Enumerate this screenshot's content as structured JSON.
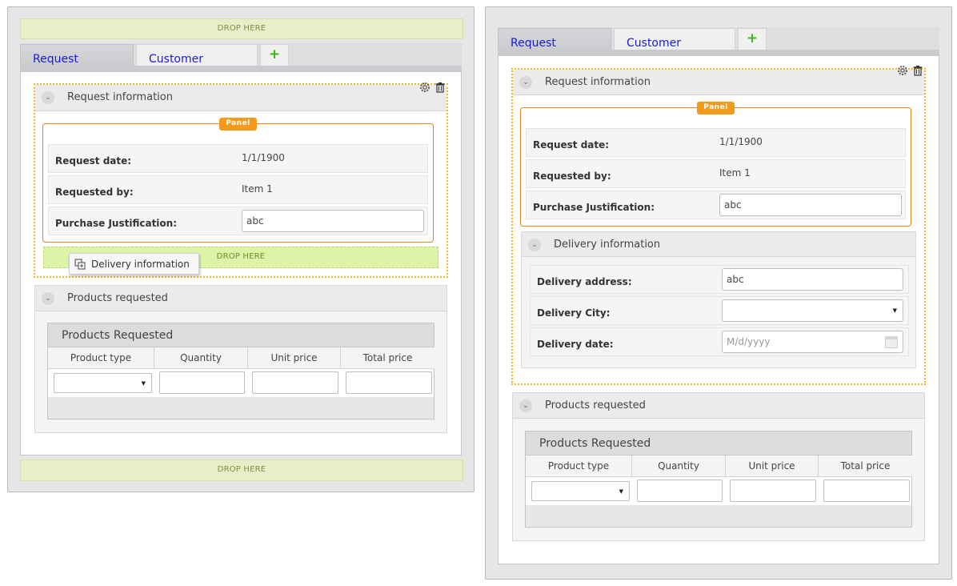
{
  "drop_label": "DROP HERE",
  "tabs": {
    "request": "Request",
    "customer": "Customer",
    "add": "+"
  },
  "sections": {
    "request_info": "Request information",
    "delivery_info": "Delivery information",
    "products_requested": "Products requested"
  },
  "panel_tag": "Panel",
  "request_fields": {
    "request_date_label": "Request date:",
    "request_date_value": "1/1/1900",
    "requested_by_label": "Requested by:",
    "requested_by_value": "Item 1",
    "justification_label": "Purchase Justification:",
    "justification_value": "abc"
  },
  "delivery_fields": {
    "address_label": "Delivery address:",
    "address_value": "abc",
    "city_label": "Delivery City:",
    "city_value": "",
    "date_label": "Delivery date:",
    "date_placeholder": "M/d/yyyy"
  },
  "drag_tooltip": "Delivery information",
  "products_grid": {
    "title": "Products Requested",
    "columns": [
      "Product type",
      "Quantity",
      "Unit price",
      "Total price"
    ]
  },
  "icons": [
    "gear-icon",
    "trash-icon",
    "chevron-down-icon",
    "calendar-icon",
    "drag-copy-icon"
  ],
  "colors": {
    "tab_text": "#1a1ad6",
    "panel_border": "#e0861a",
    "panel_tag": "#f39a1a",
    "selection": "#f5b325",
    "drop_zone": "#e7efc8",
    "add_icon": "#3fb61d"
  }
}
